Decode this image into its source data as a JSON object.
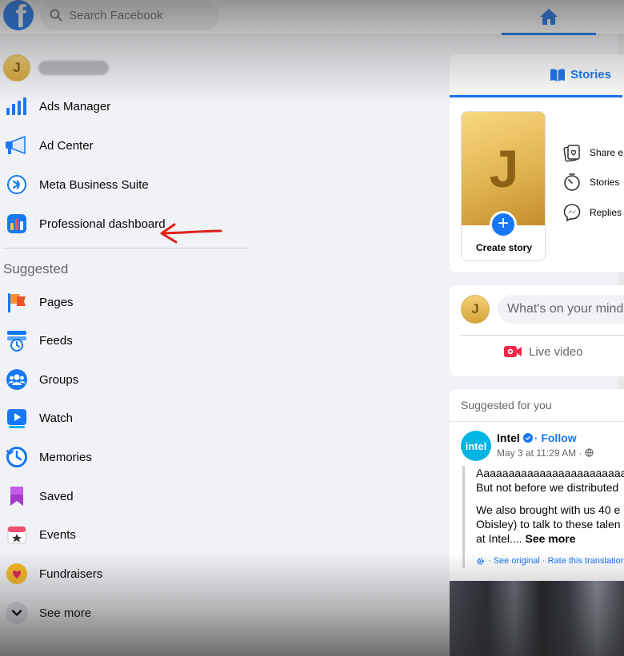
{
  "topbar": {
    "logo_letter": "f",
    "search_placeholder": "Search Facebook"
  },
  "sidebar": {
    "profile_initial": "J",
    "items": [
      {
        "label": "Ads Manager",
        "icon": "ads-manager-icon"
      },
      {
        "label": "Ad Center",
        "icon": "megaphone-icon"
      },
      {
        "label": "Meta Business Suite",
        "icon": "business-suite-icon"
      },
      {
        "label": "Professional dashboard",
        "icon": "dashboard-icon"
      }
    ],
    "suggested_title": "Suggested",
    "suggested": [
      {
        "label": "Pages",
        "icon": "flag-icon"
      },
      {
        "label": "Feeds",
        "icon": "feeds-icon"
      },
      {
        "label": "Groups",
        "icon": "groups-icon"
      },
      {
        "label": "Watch",
        "icon": "watch-icon"
      },
      {
        "label": "Memories",
        "icon": "clock-icon"
      },
      {
        "label": "Saved",
        "icon": "bookmark-icon"
      },
      {
        "label": "Events",
        "icon": "calendar-icon"
      },
      {
        "label": "Fundraisers",
        "icon": "heart-icon"
      },
      {
        "label": "See more",
        "icon": "chevron-down-icon"
      }
    ]
  },
  "stories": {
    "tab_label": "Stories",
    "create_initial": "J",
    "create_label": "Create story",
    "tips": [
      "Share e",
      "Stories",
      "Replies"
    ]
  },
  "composer": {
    "initial": "J",
    "placeholder": "What's on your mind",
    "live_label": "Live video"
  },
  "suggested_post": {
    "title": "Suggested for you",
    "logo_text": "intel",
    "author": "Intel",
    "follow": "· Follow",
    "meta": "May 3 at 11:29 AM ·",
    "line1": "Aaaaaaaaaaaaaaaaaaaaaaaaa",
    "line2": "But not before we distributed",
    "line3": "We also brought with us 40 e",
    "line4": "Obisley) to talk to these talen",
    "line5": "at Intel....",
    "see_more": "See more",
    "translate": "· See original · Rate this translation"
  },
  "colors": {
    "brand": "#1877f2",
    "annotation_arrow": "#e0201b"
  }
}
